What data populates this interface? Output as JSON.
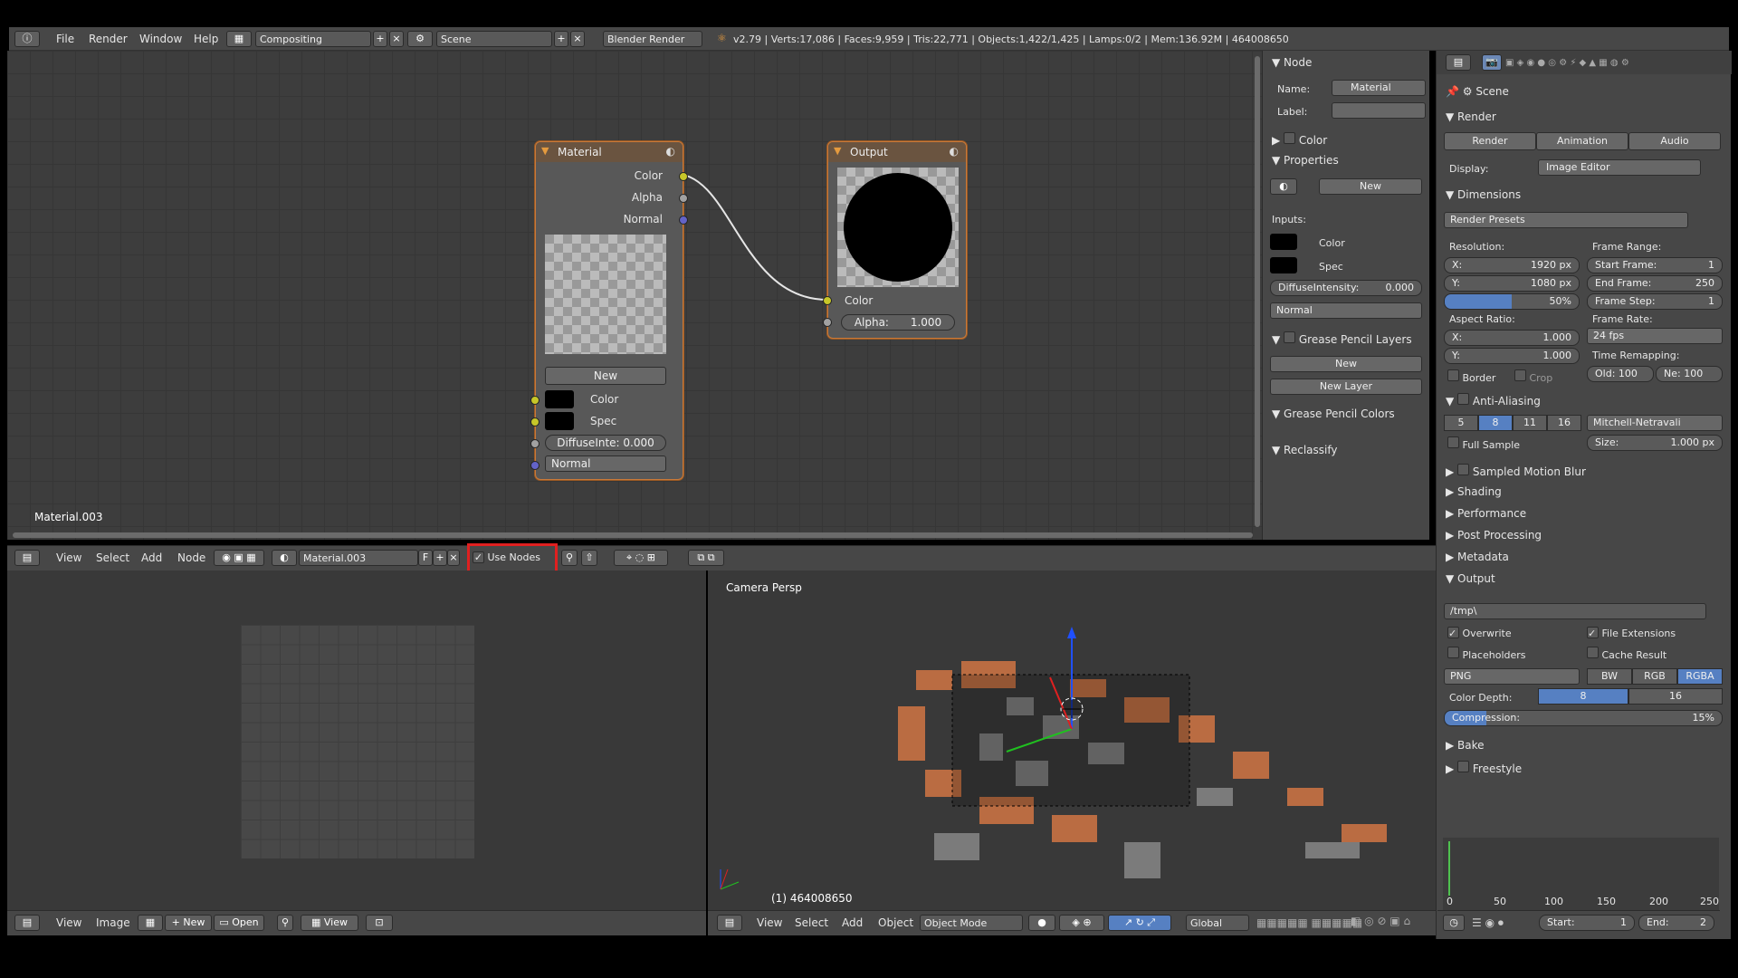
{
  "topbar": {
    "menus": [
      "File",
      "Render",
      "Window",
      "Help"
    ],
    "screen": "Compositing",
    "scene": "Scene",
    "engine": "Blender Render",
    "stats": "v2.79 | Verts:17,086 | Faces:9,959 | Tris:22,771 | Objects:1,422/1,425 | Lamps:0/2 | Mem:136.92M | 464008650"
  },
  "node_editor": {
    "material_name": "Material.003",
    "material_node": {
      "title": "Material",
      "outputs": [
        "Color",
        "Alpha",
        "Normal"
      ],
      "new_label": "New",
      "inputs": [
        "Color",
        "Spec"
      ],
      "diffuse": "DiffuseInte: 0.000",
      "normal": "Normal"
    },
    "output_node": {
      "title": "Output",
      "color_label": "Color",
      "alpha": "Alpha:",
      "alpha_value": "1.000"
    }
  },
  "node_panel": {
    "node_section": "Node",
    "name_label": "Name:",
    "name_value": "Material",
    "label_label": "Label:",
    "color_section": "Color",
    "properties_section": "Properties",
    "new_label": "New",
    "inputs_label": "Inputs:",
    "color_input": "Color",
    "spec_input": "Spec",
    "diffuse": "DiffuseIntensity:",
    "diffuse_value": "0.000",
    "normal": "Normal",
    "gp_layers": "Grease Pencil Layers",
    "gp_new": "New",
    "new_layer": "New Layer",
    "gp_colors": "Grease Pencil Colors",
    "reclassify": "Reclassify"
  },
  "editor_header": {
    "menus": [
      "View",
      "Select",
      "Add",
      "Node"
    ],
    "material": "Material.003",
    "fake": "F",
    "use_nodes": "Use Nodes"
  },
  "properties": {
    "scene": "Scene",
    "render_section": "Render",
    "render_btn": "Render",
    "animation_btn": "Animation",
    "audio_btn": "Audio",
    "display_label": "Display:",
    "display_value": "Image Editor",
    "dimensions": "Dimensions",
    "presets": "Render Presets",
    "resolution": "Resolution:",
    "res_x": "1920 px",
    "res_y": "1080 px",
    "res_pct": "50%",
    "frame_range": "Frame Range:",
    "start_frame": "Start Frame:",
    "start_val": "1",
    "end_frame": "End Frame:",
    "end_val": "250",
    "frame_step": "Frame Step:",
    "step_val": "1",
    "aspect": "Aspect Ratio:",
    "asp_x": "1.000",
    "asp_y": "1.000",
    "frame_rate": "Frame Rate:",
    "fps": "24 fps",
    "border": "Border",
    "crop": "Crop",
    "time_remap": "Time Remapping:",
    "old": "Old: 100",
    "new": "Ne: 100",
    "aa": "Anti-Aliasing",
    "aa_samples": [
      "5",
      "8",
      "11",
      "16"
    ],
    "aa_filter": "Mitchell-Netravali",
    "full_sample": "Full Sample",
    "size_label": "Size:",
    "size_val": "1.000 px",
    "sections": [
      "Sampled Motion Blur",
      "Shading",
      "Performance",
      "Post Processing",
      "Metadata"
    ],
    "output": "Output",
    "path": "/tmp\\",
    "overwrite": "Overwrite",
    "file_ext": "File Extensions",
    "placeholders": "Placeholders",
    "cache": "Cache Result",
    "format": "PNG",
    "bw": "BW",
    "rgb": "RGB",
    "rgba": "RGBA",
    "color_depth": "Color Depth:",
    "depth8": "8",
    "depth16": "16",
    "compression": "Compression:",
    "comp_val": "15%",
    "bake": "Bake",
    "freestyle": "Freestyle"
  },
  "image_editor": {
    "menus": [
      "View",
      "Image"
    ],
    "new": "New",
    "open": "Open",
    "view": "View"
  },
  "viewport": {
    "label": "Camera Persp",
    "frame_info": "(1) 464008650",
    "menus": [
      "View",
      "Select",
      "Add",
      "Object"
    ],
    "mode": "Object Mode",
    "orientation": "Global"
  },
  "timeline": {
    "ticks": [
      "0",
      "50",
      "100",
      "150",
      "200",
      "250"
    ],
    "start": "Start:",
    "start_val": "1",
    "end": "End:",
    "end_val": "2"
  },
  "colors": {
    "accent": "#5680c2",
    "highlight": "#e02020",
    "node_border": "#c8793a"
  }
}
